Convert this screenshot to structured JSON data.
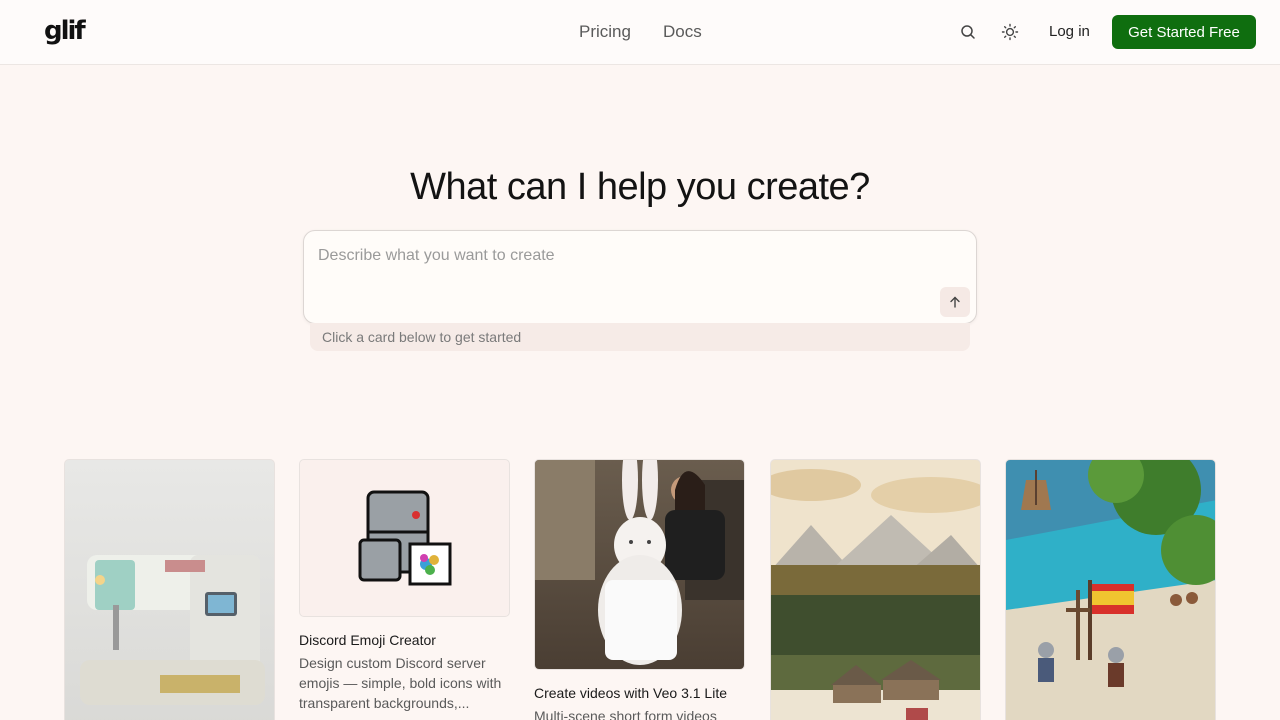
{
  "header": {
    "logo": "glif",
    "nav": [
      "Pricing",
      "Docs"
    ],
    "login": "Log in",
    "cta": "Get Started Free"
  },
  "hero": {
    "title": "What can I help you create?",
    "placeholder": "Describe what you want to create",
    "hint": "Click a card below to get started"
  },
  "cards": [
    {
      "title": "",
      "desc": ""
    },
    {
      "title": "Discord Emoji Creator",
      "desc": "Design custom Discord server emojis — simple, bold icons with transparent backgrounds,..."
    },
    {
      "title": "Create videos with Veo 3.1 Lite",
      "desc": "Multi-scene short form videos"
    },
    {
      "title": "",
      "desc": ""
    },
    {
      "title": "",
      "desc": ""
    }
  ],
  "colors": {
    "brand": "#0f6e0f",
    "background": "#fdf6f3"
  }
}
